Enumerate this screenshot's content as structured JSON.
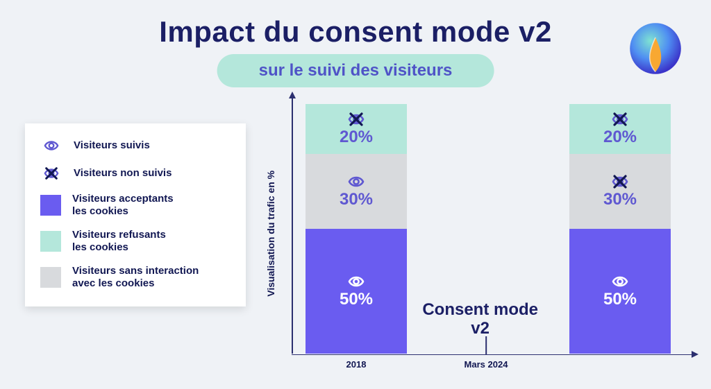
{
  "header": {
    "title": "Impact du consent mode v2",
    "subtitle": "sur le suivi des visiteurs"
  },
  "legend": {
    "tracked": "Visiteurs suivis",
    "untracked": "Visiteurs non suivis",
    "accept": "Visiteurs acceptants\nles cookies",
    "refuse": "Visiteurs refusants\nles cookies",
    "nointeract": "Visiteurs sans interaction\navec les cookies"
  },
  "chart": {
    "ylabel": "Visualisation du trafic en %",
    "midlabel": "Consent mode\nv2",
    "ticks": {
      "t0": "2018",
      "t1": "Mars 2024"
    },
    "bars": {
      "left": {
        "accept": "50%",
        "nointeract": "30%",
        "refuse": "20%"
      },
      "right": {
        "accept": "50%",
        "nointeract": "30%",
        "refuse": "20%"
      }
    }
  },
  "colors": {
    "purple": "#6a5cf0",
    "mint": "#b4e7db",
    "grey": "#d8dadd",
    "navy": "#1b1f65"
  },
  "chart_data": {
    "type": "bar",
    "title": "Impact du consent mode v2 sur le suivi des visiteurs",
    "ylabel": "Visualisation du trafic en %",
    "xlabel": "",
    "ylim": [
      0,
      100
    ],
    "categories": [
      "2018",
      "Mars 2024"
    ],
    "series": [
      {
        "name": "Visiteurs acceptants les cookies",
        "values": [
          50,
          50
        ],
        "tracked": [
          true,
          true
        ]
      },
      {
        "name": "Visiteurs sans interaction avec les cookies",
        "values": [
          30,
          30
        ],
        "tracked": [
          true,
          false
        ]
      },
      {
        "name": "Visiteurs refusants les cookies",
        "values": [
          20,
          20
        ],
        "tracked": [
          false,
          false
        ]
      }
    ],
    "annotations": [
      {
        "x": "Mars 2024",
        "text": "Consent mode v2"
      }
    ],
    "legend_extra": [
      {
        "icon": "eye",
        "label": "Visiteurs suivis"
      },
      {
        "icon": "eye-crossed",
        "label": "Visiteurs non suivis"
      }
    ]
  }
}
